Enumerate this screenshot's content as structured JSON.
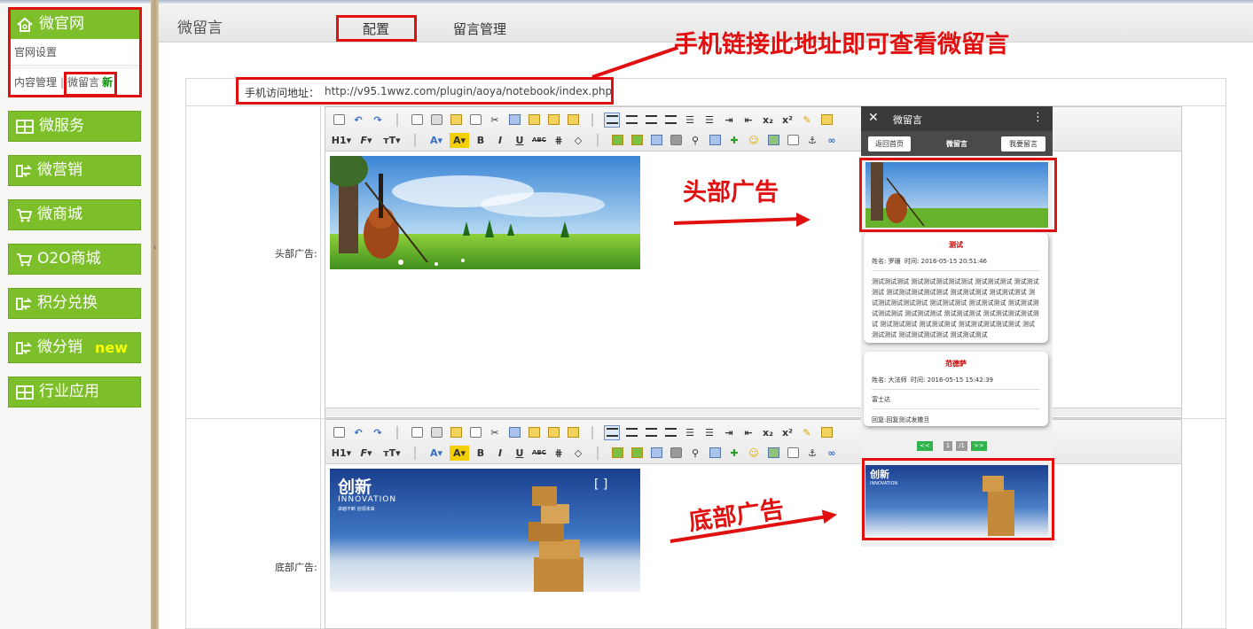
{
  "sidebar": {
    "top_item": {
      "label": "微官网",
      "icon": "home-icon"
    },
    "sub_items": {
      "site_settings": "官网设置",
      "content_mgmt": "内容管理",
      "separator": "|",
      "wechat_message": "微留言",
      "wechat_message_badge": "新"
    },
    "items": [
      {
        "label": "微服务",
        "icon": "grid-icon"
      },
      {
        "label": "微营销",
        "icon": "swap-icon"
      },
      {
        "label": "微商城",
        "icon": "cart-icon"
      },
      {
        "label": "O2O商城",
        "icon": "cart-icon"
      },
      {
        "label": "积分兑换",
        "icon": "swap-icon"
      },
      {
        "label": "微分销",
        "icon": "swap-icon",
        "badge": "new"
      },
      {
        "label": "行业应用",
        "icon": "grid-icon"
      }
    ]
  },
  "header": {
    "page_title": "微留言",
    "tabs": [
      {
        "label": "配置",
        "active": true
      },
      {
        "label": "留言管理",
        "active": false
      }
    ]
  },
  "annotations": {
    "top": "手机链接此地址即可查看微留言",
    "header_ad": "头部广告",
    "footer_ad": "底部广告",
    "color": "#e01010"
  },
  "form": {
    "url_label": "手机访问地址：",
    "url_value": "http://v95.1wwz.com/plugin/aoya/notebook/index.php",
    "header_ad_label": "头部广告:",
    "footer_ad_label": "底部广告:"
  },
  "editor": {
    "toolbar_row1": [
      "source",
      "undo",
      "redo",
      "preview",
      "print",
      "template",
      "code",
      "cut",
      "copy",
      "paste",
      "paste-text",
      "paste-word",
      "align-left",
      "align-center",
      "align-right",
      "align-justify",
      "ordered-list",
      "unordered-list",
      "indent",
      "outdent",
      "subscript",
      "superscript",
      "clear",
      "quick-format"
    ],
    "toolbar_row2": [
      "heading",
      "font-family",
      "font-size",
      "font-color",
      "highlight",
      "bold",
      "italic",
      "underline",
      "strikethrough",
      "line-height",
      "remove-format",
      "image",
      "multi-image",
      "flash",
      "media",
      "attachment",
      "table",
      "hr",
      "emoticon",
      "map",
      "page-break",
      "anchor",
      "link"
    ],
    "row2_labels": {
      "heading": "H1",
      "font": "F",
      "size": "тT",
      "color": "A",
      "hl": "A",
      "bold": "B",
      "italic": "I",
      "underline": "U",
      "strike": "ABC"
    },
    "footer_banner_text": {
      "title": "创新",
      "subtitle": "INNOVATION",
      "tag": "卓越不断 创领未来"
    }
  },
  "phone": {
    "title": "微留言",
    "back_button": "返回首页",
    "center_title": "微留言",
    "leave_message_button": "我要留言",
    "messages": [
      {
        "title": "测试",
        "name_label": "姓名:",
        "name": "罗珊",
        "time_label": "时间:",
        "time": "2016-05-15 20:51:46",
        "body": "测试测试测试 测试测试测试测试测试 测试测试测试 测试测试测试 测试测试测试测试测试 测试测试测试 测试测试测试 测试测试测试测试测试 测试测试测试 测试测试测试 测试测试测试测试测试 测试测试测试 测试测试测试 测试测试测试测试测试 测试测试测试 测试测试测试 测试测试测试测试测试 测试测试测试 测试测试测试测试 测试测试测试"
      },
      {
        "title": "范德萨",
        "name_label": "姓名:",
        "name": "大法师",
        "time_label": "时间:",
        "time": "2016-05-15 15:42:39",
        "body": "富士达",
        "reply": "回复:回复测试发撒旦"
      }
    ],
    "pager": {
      "prev": "<<",
      "page": "1",
      "total": "/1",
      "next": ">>"
    }
  }
}
